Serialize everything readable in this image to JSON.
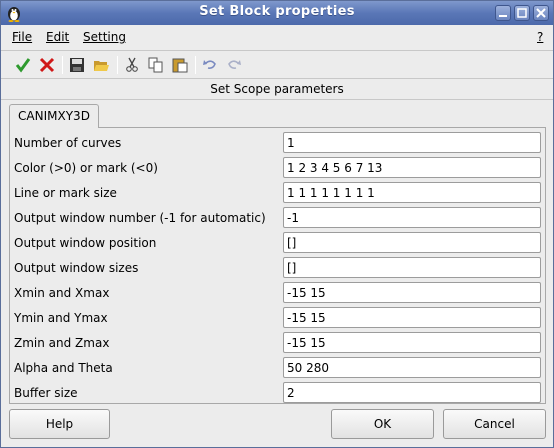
{
  "window": {
    "title": "Set Block properties"
  },
  "menu": {
    "file": "File",
    "edit": "Edit",
    "setting": "Setting",
    "help": "?"
  },
  "toolbar": {
    "icons": [
      "check-icon",
      "cross-icon",
      "save-icon",
      "open-folder-icon",
      "cut-icon",
      "copy-icon",
      "paste-icon",
      "undo-icon",
      "redo-icon"
    ]
  },
  "subtitle": "Set Scope parameters",
  "tab": {
    "label": "CANIMXY3D"
  },
  "params": [
    {
      "label": "Number of curves",
      "value": "1"
    },
    {
      "label": "Color (>0) or mark (<0)",
      "value": "1 2 3 4 5 6 7 13"
    },
    {
      "label": "Line or mark size",
      "value": "1 1 1 1 1 1 1 1"
    },
    {
      "label": "Output window number (-1 for automatic)",
      "value": "-1"
    },
    {
      "label": "Output window position",
      "value": "[]"
    },
    {
      "label": "Output window sizes",
      "value": "[]"
    },
    {
      "label": "Xmin and Xmax",
      "value": "-15 15"
    },
    {
      "label": "Ymin and Ymax",
      "value": "-15 15"
    },
    {
      "label": "Zmin and Zmax",
      "value": "-15 15"
    },
    {
      "label": "Alpha and Theta",
      "value": "50 280"
    },
    {
      "label": "Buffer size",
      "value": "2"
    }
  ],
  "buttons": {
    "help": "Help",
    "ok": "OK",
    "cancel": "Cancel"
  },
  "colors": {
    "titlebar": "#5a77b7",
    "check": "#2e9a2e",
    "cross": "#d01818"
  }
}
